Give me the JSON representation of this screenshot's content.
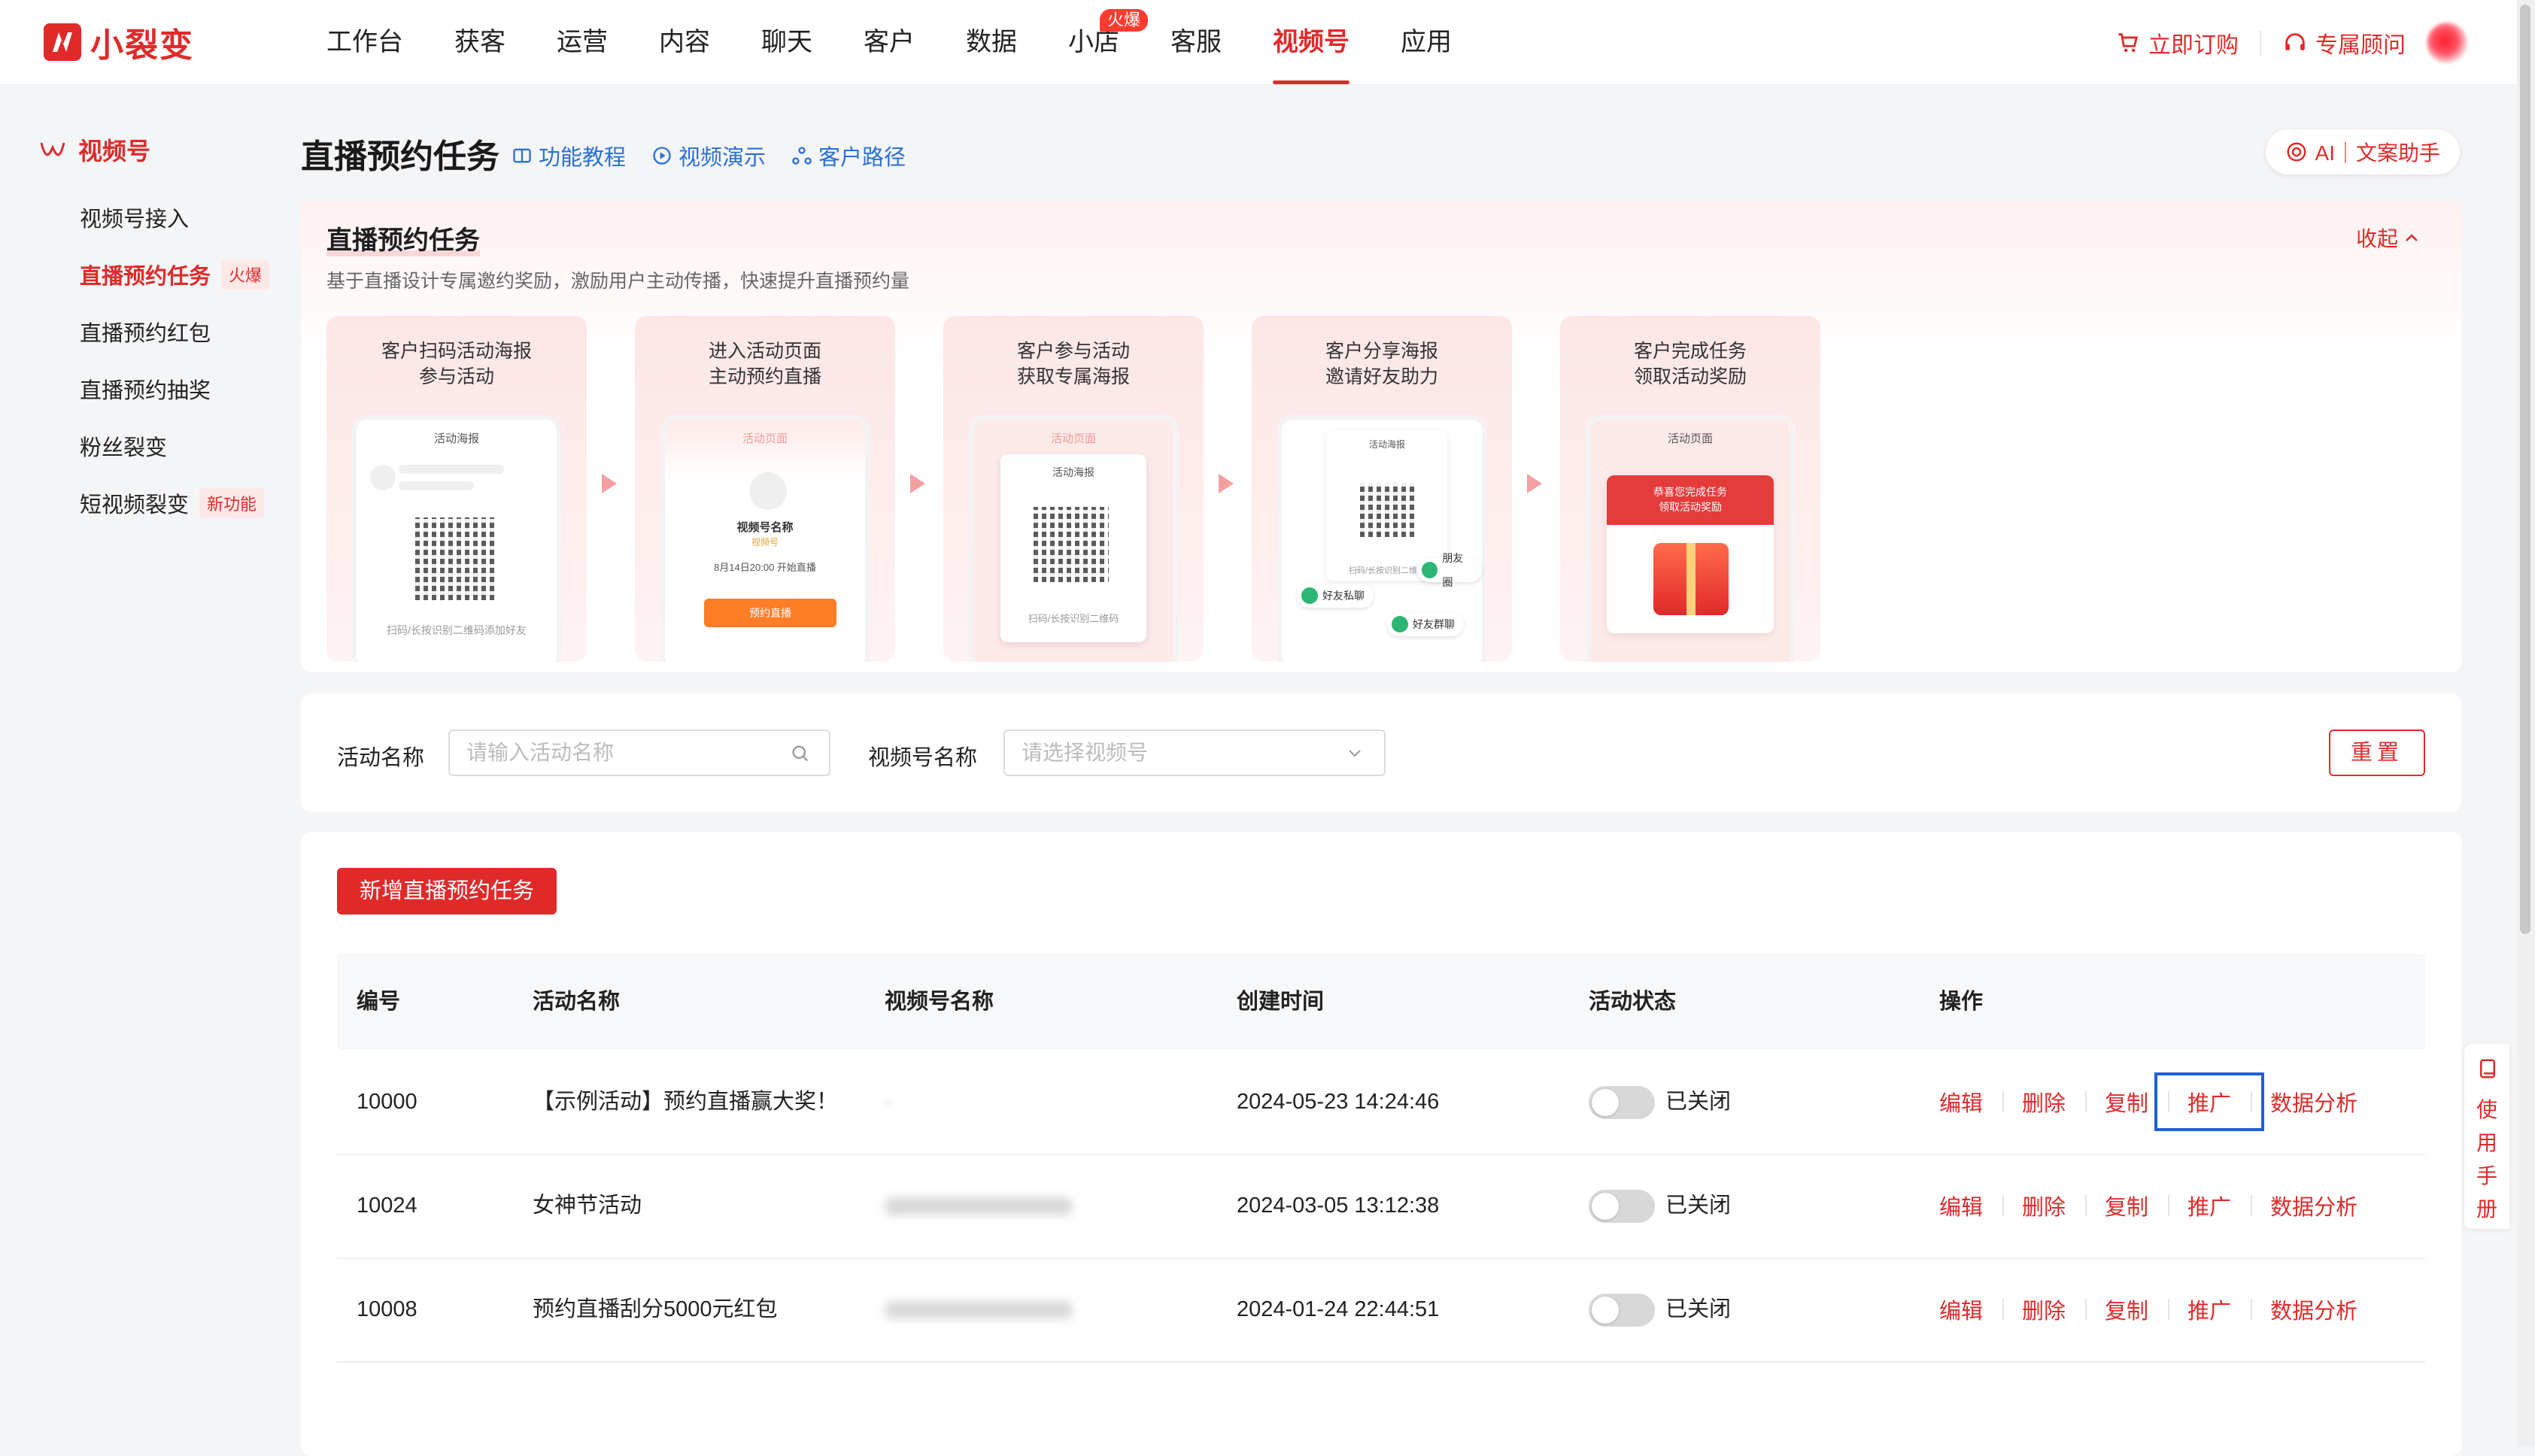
{
  "app": {
    "logo_text": "小裂变"
  },
  "nav": {
    "items": [
      {
        "label": "工作台"
      },
      {
        "label": "获客"
      },
      {
        "label": "运营"
      },
      {
        "label": "内容"
      },
      {
        "label": "聊天"
      },
      {
        "label": "客户"
      },
      {
        "label": "数据"
      },
      {
        "label": "小店",
        "badge": "火爆"
      },
      {
        "label": "客服"
      },
      {
        "label": "视频号",
        "active": true
      },
      {
        "label": "应用"
      }
    ],
    "order_label": "立即订购",
    "advisor_label": "专属顾问"
  },
  "sidebar": {
    "title": "视频号",
    "items": [
      {
        "label": "视频号接入"
      },
      {
        "label": "直播预约任务",
        "tag": "火爆"
      },
      {
        "label": "直播预约红包"
      },
      {
        "label": "直播预约抽奖"
      },
      {
        "label": "粉丝裂变"
      },
      {
        "label": "短视频裂变",
        "tag": "新功能"
      }
    ]
  },
  "header": {
    "title": "直播预约任务",
    "links": [
      "功能教程",
      "视频演示",
      "客户路径"
    ],
    "ai_label": "AI｜文案助手"
  },
  "intro": {
    "title": "直播预约任务",
    "desc": "基于直播设计专属邀约奖励，激励用户主动传播，快速提升直播预约量",
    "collapse_label": "收起",
    "steps": [
      {
        "line1": "客户扫码活动海报",
        "line2": "参与活动",
        "screen": "活动海报",
        "caption": "扫码/长按识别二维码添加好友"
      },
      {
        "line1": "进入活动页面",
        "line2": "主动预约直播",
        "screen": "活动页面",
        "channel": "视频号名称",
        "channel_sub": "视频号",
        "time": "8月14日20:00 开始直播",
        "button": "预约直播"
      },
      {
        "line1": "客户参与活动",
        "line2": "获取专属海报",
        "screen": "活动页面",
        "poster": "活动海报",
        "caption": "扫码/长按识别二维码"
      },
      {
        "line1": "客户分享海报",
        "line2": "邀请好友助力",
        "screen": "活动海报",
        "caption": "扫码/长按识别二维码",
        "chips": [
          "朋友圈",
          "好友私聊",
          "好友群聊"
        ]
      },
      {
        "line1": "客户完成任务",
        "line2": "领取活动奖励",
        "screen": "活动页面",
        "reward_l1": "恭喜您完成任务",
        "reward_l2": "领取活动奖励"
      }
    ]
  },
  "filter": {
    "activity_label": "活动名称",
    "activity_placeholder": "请输入活动名称",
    "channel_label": "视频号名称",
    "channel_placeholder": "请选择视频号",
    "reset_label": "重置"
  },
  "table": {
    "add_label": "新增直播预约任务",
    "columns": [
      "编号",
      "活动名称",
      "视频号名称",
      "创建时间",
      "活动状态",
      "操作"
    ],
    "rows": [
      {
        "id": "10000",
        "name": "【示例活动】预约直播赢大奖！",
        "channel": "-",
        "created": "2024-05-23 14:24:46",
        "status": "已关闭"
      },
      {
        "id": "10024",
        "name": "女神节活动",
        "channel": "",
        "created": "2024-03-05 13:12:38",
        "status": "已关闭"
      },
      {
        "id": "10008",
        "name": "预约直播刮分5000元红包",
        "channel": "",
        "created": "2024-01-24 22:44:51",
        "status": "已关闭"
      }
    ],
    "ops": [
      "编辑",
      "删除",
      "复制",
      "推广",
      "数据分析"
    ]
  },
  "rail": {
    "label": "使用手册"
  }
}
